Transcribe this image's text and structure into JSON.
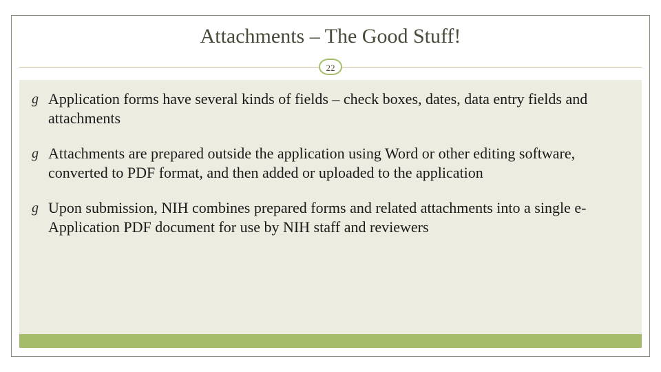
{
  "title": "Attachments – The Good Stuff!",
  "page_number": "22",
  "bullets": [
    "Application forms have several kinds of fields – check boxes, dates, data entry fields and attachments",
    "Attachments are prepared outside the application using Word or other editing software, converted to PDF format, and then added or uploaded to the application",
    "Upon submission, NIH combines prepared forms and related attachments into a single e-Application PDF document for use by NIH staff and reviewers"
  ],
  "bullet_glyph": "g",
  "colors": {
    "accent_green": "#a5bd6a",
    "panel_bg": "#edece0",
    "frame_border": "#8d8a77",
    "rule": "#c9b89a",
    "title_color": "#4a4a3a"
  }
}
